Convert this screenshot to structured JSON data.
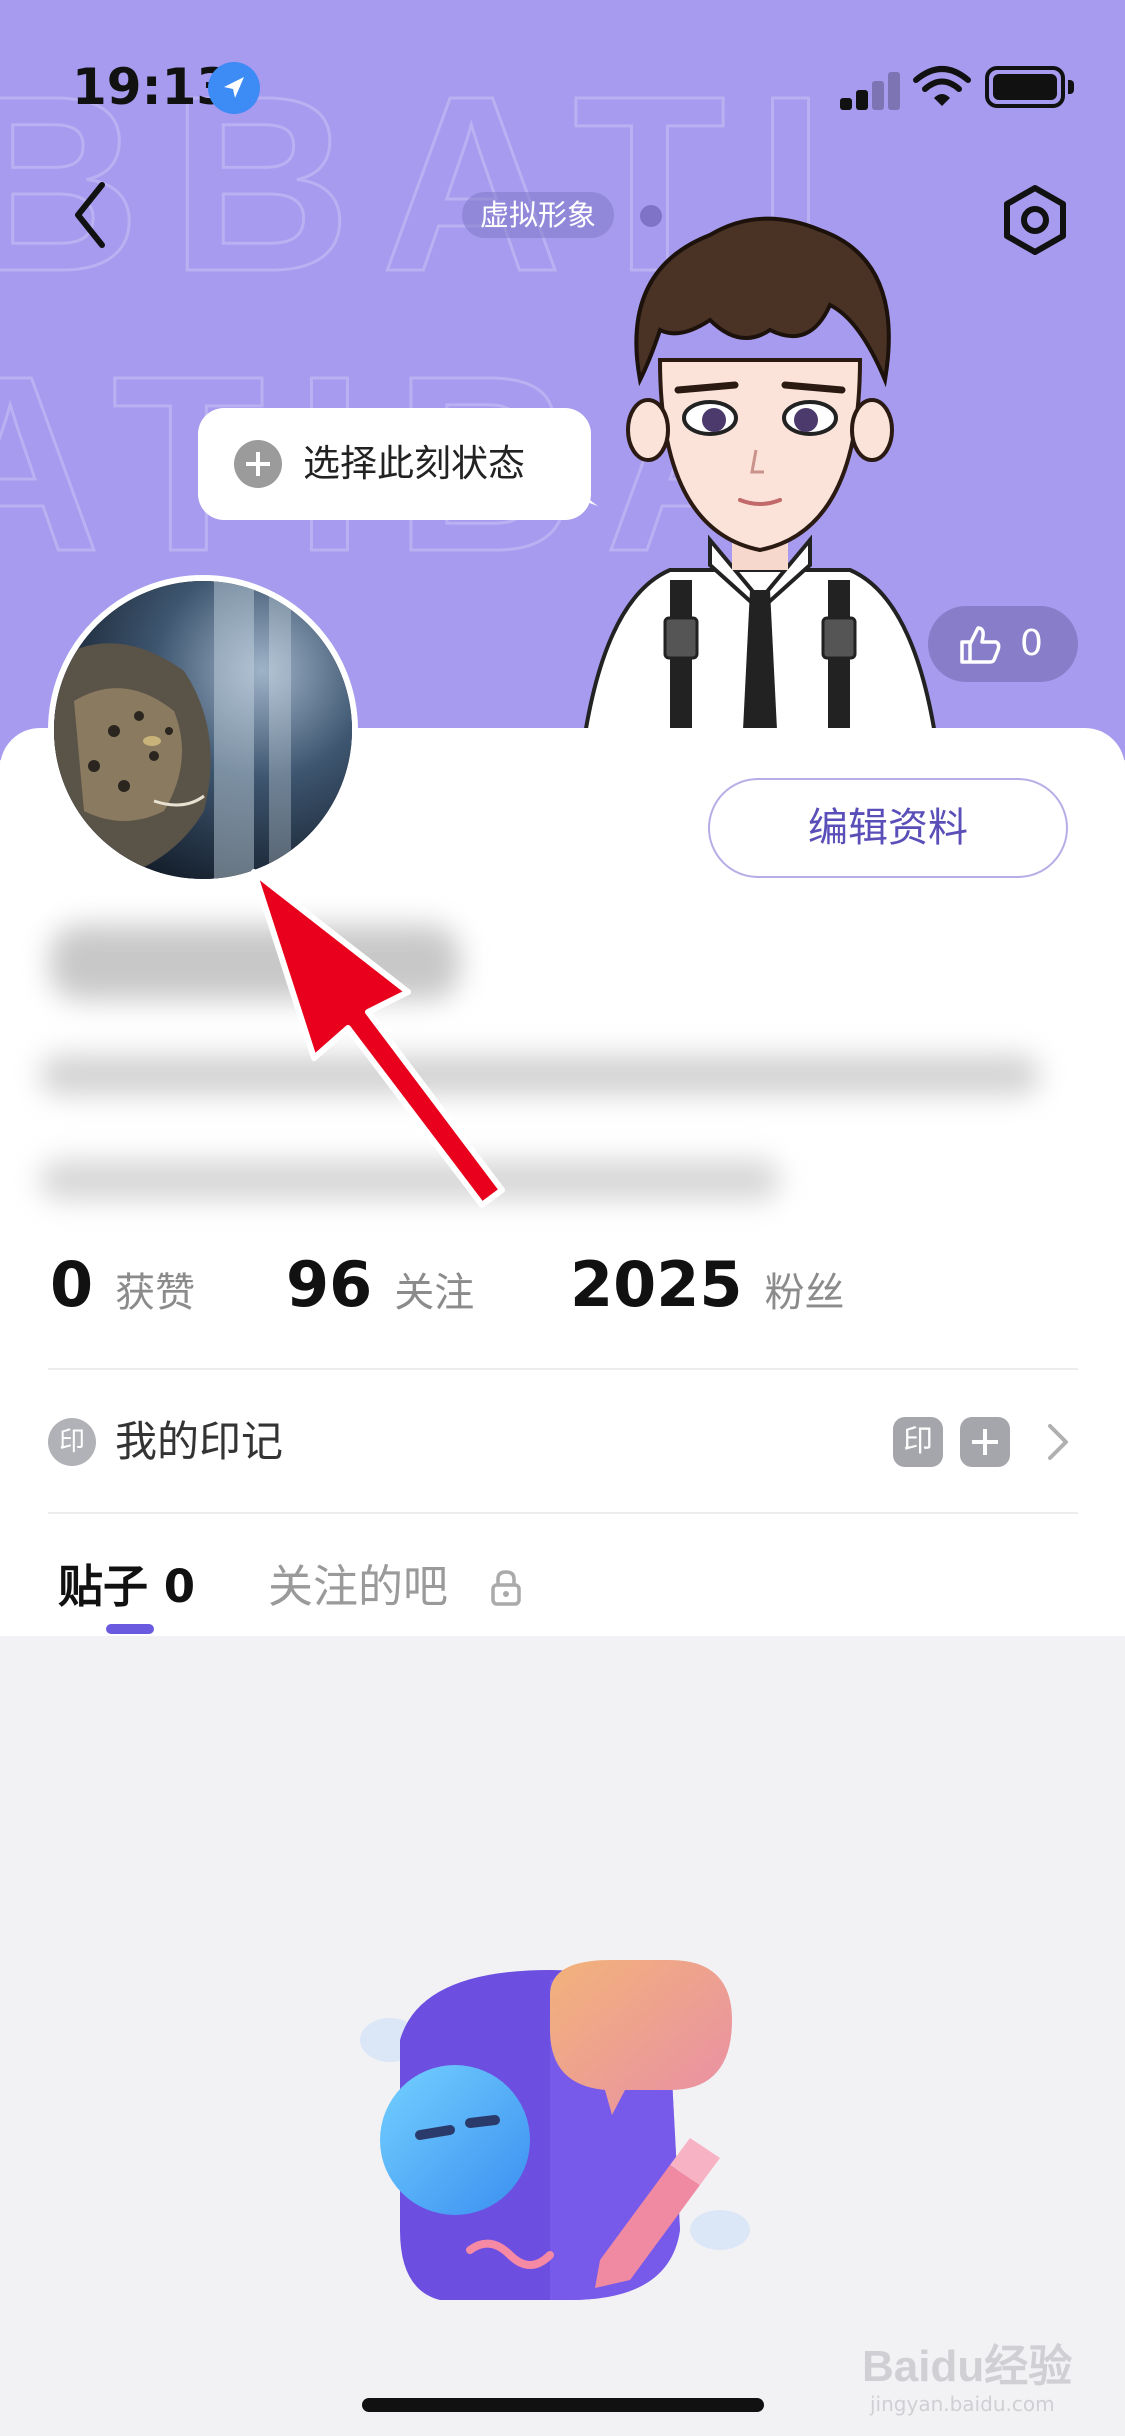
{
  "status_bar": {
    "time": "19:13"
  },
  "header": {
    "avatar_tag": "虚拟形象",
    "state_prompt": "选择此刻状态",
    "like_count": "0",
    "watermark_letters": [
      "B",
      "A",
      "T",
      "I"
    ]
  },
  "profile": {
    "edit_button": "编辑资料"
  },
  "stats": [
    {
      "value": "0",
      "label": "获赞"
    },
    {
      "value": "96",
      "label": "关注"
    },
    {
      "value": "2025",
      "label": "粉丝"
    }
  ],
  "marks": {
    "label": "我的印记",
    "icon_char": "印",
    "badge_char": "印"
  },
  "tabs": {
    "posts_label": "贴子",
    "posts_count": "0",
    "followed_bars": "关注的吧"
  },
  "watermark": {
    "brand": "Baidu经验",
    "url": "jingyan.baidu.com"
  },
  "colors": {
    "header_bg": "#a69bef",
    "accent": "#6a5ae0",
    "annotation_arrow": "#e8001c"
  }
}
